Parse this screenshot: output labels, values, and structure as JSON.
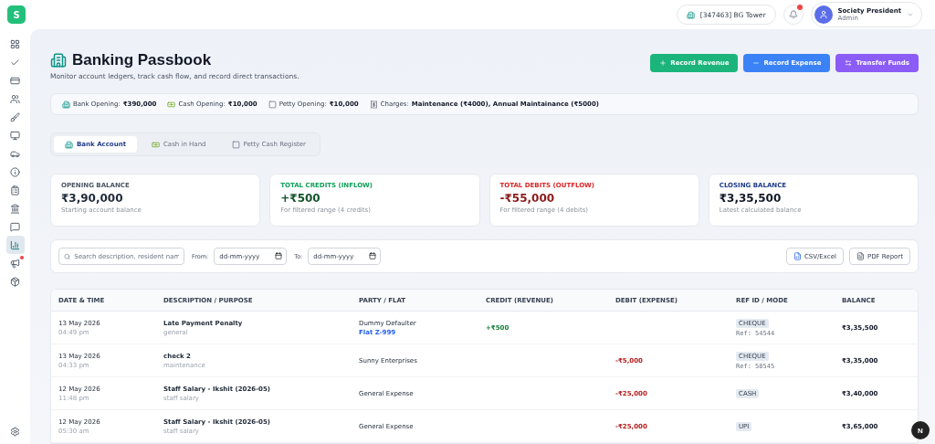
{
  "app": {
    "logo": "S"
  },
  "sidebar": {
    "items": [
      {
        "selected": false,
        "dot": false
      },
      {
        "selected": false,
        "dot": false
      },
      {
        "selected": false,
        "dot": false
      },
      {
        "selected": false,
        "dot": false
      },
      {
        "selected": false,
        "dot": false
      },
      {
        "selected": false,
        "dot": false
      },
      {
        "selected": false,
        "dot": false
      },
      {
        "selected": false,
        "dot": false
      },
      {
        "selected": false,
        "dot": false
      },
      {
        "selected": false,
        "dot": false
      },
      {
        "selected": false,
        "dot": false
      },
      {
        "selected": true,
        "dot": false
      },
      {
        "selected": false,
        "dot": true
      },
      {
        "selected": false,
        "dot": false
      }
    ]
  },
  "topbar": {
    "society": "[347463] BG Tower",
    "notifications": {
      "unread": true
    },
    "user": {
      "name": "Society President",
      "role": "Admin"
    }
  },
  "page": {
    "title": "Banking Passbook",
    "subtitle": "Monitor account ledgers, track cash flow, and record direct transactions."
  },
  "actions": [
    {
      "kind": "revenue",
      "label": "Record Revenue"
    },
    {
      "kind": "expense",
      "label": "Record Expense"
    },
    {
      "kind": "transfer",
      "label": "Transfer Funds"
    }
  ],
  "summary": [
    {
      "kind": "bank",
      "label": "Bank Opening:",
      "value": "₹390,000"
    },
    {
      "kind": "cash",
      "label": "Cash Opening:",
      "value": "₹10,000"
    },
    {
      "kind": "petty",
      "label": "Petty Opening:",
      "value": "₹10,000"
    },
    {
      "kind": "charges",
      "label": "Charges:",
      "value": "Maintenance (₹4000), Annual Maintainance (₹5000)"
    }
  ],
  "tabs": [
    {
      "kind": "bank",
      "label": "Bank Account",
      "selected": true
    },
    {
      "kind": "cash",
      "label": "Cash in Hand",
      "selected": false
    },
    {
      "kind": "petty",
      "label": "Petty Cash Register",
      "selected": false
    }
  ],
  "cards": [
    {
      "kind": "neutral",
      "label": "OPENING BALANCE",
      "amount": "₹3,90,000",
      "note": "Starting account balance"
    },
    {
      "kind": "credit",
      "label": "TOTAL CREDITS (INFLOW)",
      "amount": "+₹500",
      "note": "For filtered range (4 credits)"
    },
    {
      "kind": "debit",
      "label": "TOTAL DEBITS (OUTFLOW)",
      "amount": "-₹55,000",
      "note": "For filtered range (4 debits)"
    },
    {
      "kind": "closing",
      "label": "CLOSING BALANCE",
      "amount": "₹3,35,500",
      "note": "Latest calculated balance"
    }
  ],
  "filters": {
    "search": {
      "placeholder": "Search description, resident nam"
    },
    "from": {
      "label": "From:",
      "placeholder": "dd-mm-yyyy"
    },
    "to": {
      "label": "To:",
      "placeholder": "dd-mm-yyyy"
    },
    "exports": [
      {
        "kind": "csv",
        "label": "CSV/Excel"
      },
      {
        "kind": "pdf",
        "label": "PDF Report"
      }
    ]
  },
  "table": {
    "columns": [
      "DATE & TIME",
      "DESCRIPTION / PURPOSE",
      "PARTY / FLAT",
      "CREDIT (REVENUE)",
      "DEBIT (EXPENSE)",
      "REF ID / MODE",
      "BALANCE"
    ],
    "rows": [
      {
        "date": "13 May 2026",
        "time": "04:49 pm",
        "description": "Late Payment Penalty",
        "purpose": "general",
        "party": "Dummy Defaulter",
        "flat": "Flat Z-999",
        "credit": "+₹500",
        "mode": "CHEQUE",
        "ref": "Ref: 54544",
        "balance": "₹3,35,500"
      },
      {
        "date": "13 May 2026",
        "time": "04:33 pm",
        "description": "check 2",
        "purpose": "maintenance",
        "party": "Sunny Enterprises",
        "debit": "-₹5,000",
        "mode": "CHEQUE",
        "ref": "Ref: 58545",
        "balance": "₹3,35,000"
      },
      {
        "date": "12 May 2026",
        "time": "11:48 pm",
        "description": "Staff Salary - Ikshit (2026-05)",
        "purpose": "staff salary",
        "party": "General Expense",
        "debit": "-₹25,000",
        "mode": "CASH",
        "balance": "₹3,40,000"
      },
      {
        "date": "12 May 2026",
        "time": "05:30 am",
        "description": "Staff Salary - Ikshit (2026-05)",
        "purpose": "staff salary",
        "party": "General Expense",
        "debit": "-₹25,000",
        "mode": "UPI",
        "balance": "₹3,65,000"
      }
    ]
  },
  "dev_badge": "N"
}
